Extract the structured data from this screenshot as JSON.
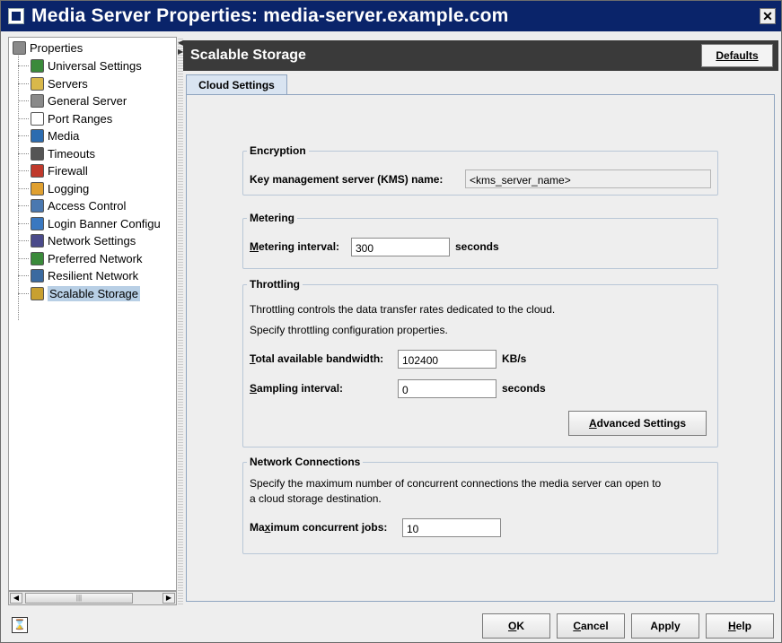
{
  "window": {
    "title": "Media Server Properties: media-server.example.com"
  },
  "tree": {
    "root": "Properties",
    "items": [
      {
        "label": "Universal Settings",
        "icon": "globe-icon",
        "color": "#3a8a3a"
      },
      {
        "label": "Servers",
        "icon": "server-icon",
        "color": "#d9b84a"
      },
      {
        "label": "General Server",
        "icon": "database-icon",
        "color": "#8a8a8a"
      },
      {
        "label": "Port Ranges",
        "icon": "port-icon",
        "color": "#ffffff"
      },
      {
        "label": "Media",
        "icon": "media-icon",
        "color": "#2c6cb0"
      },
      {
        "label": "Timeouts",
        "icon": "clock-icon",
        "color": "#555555"
      },
      {
        "label": "Firewall",
        "icon": "firewall-icon",
        "color": "#c0392b"
      },
      {
        "label": "Logging",
        "icon": "log-icon",
        "color": "#e0a030"
      },
      {
        "label": "Access Control",
        "icon": "access-icon",
        "color": "#4a78b0"
      },
      {
        "label": "Login Banner Configu",
        "icon": "banner-icon",
        "color": "#3a78c0"
      },
      {
        "label": "Network Settings",
        "icon": "network-icon",
        "color": "#4a4a8a"
      },
      {
        "label": "Preferred Network",
        "icon": "preferred-network-icon",
        "color": "#3a8a3a"
      },
      {
        "label": "Resilient Network",
        "icon": "resilient-network-icon",
        "color": "#3a6aa0"
      },
      {
        "label": "Scalable Storage",
        "icon": "storage-icon",
        "color": "#c8a030",
        "selected": true
      }
    ]
  },
  "panel": {
    "title": "Scalable Storage",
    "defaults_label": "Defaults",
    "tab_label": "Cloud Settings"
  },
  "encryption": {
    "title": "Encryption",
    "kms_label": "Key management server (KMS) name:",
    "kms_value": "<kms_server_name>"
  },
  "metering": {
    "title": "Metering",
    "interval_label": "Metering interval:",
    "interval_value": "300",
    "unit": "seconds"
  },
  "throttling": {
    "title": "Throttling",
    "desc1": "Throttling controls the data transfer rates dedicated to the cloud.",
    "desc2": "Specify throttling configuration properties.",
    "bandwidth_label": "Total available bandwidth:",
    "bandwidth_value": "102400",
    "bandwidth_unit": "KB/s",
    "sampling_label": "Sampling interval:",
    "sampling_value": "0",
    "sampling_unit": "seconds",
    "advanced_label": "Advanced Settings"
  },
  "network": {
    "title": "Network Connections",
    "desc1": "Specify the maximum number of concurrent connections the media server can open to",
    "desc2": "a cloud storage destination.",
    "max_label": "Maximum concurrent jobs:",
    "max_value": "10"
  },
  "buttons": {
    "ok": "OK",
    "cancel": "Cancel",
    "apply": "Apply",
    "help": "Help"
  }
}
